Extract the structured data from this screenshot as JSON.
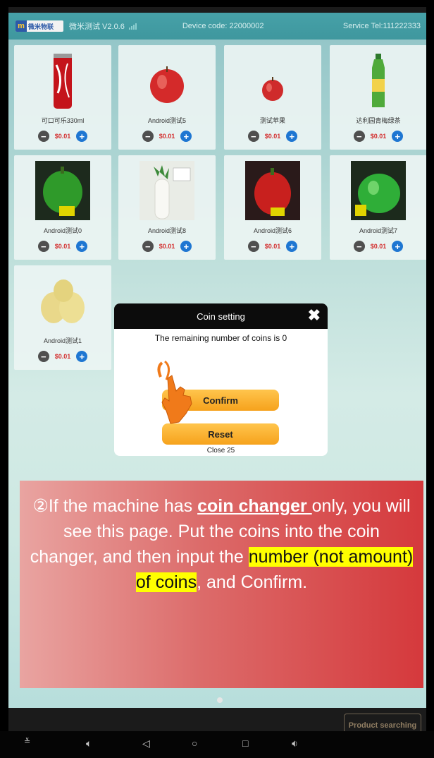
{
  "statusbar": {
    "logo_mark": "m",
    "logo_text": "微米物联",
    "app_version": "微米测试 V2.0.6",
    "device_code": "Device code:  22000002",
    "service_tel": "Service Tel:111222333"
  },
  "products": [
    {
      "name": "可口可乐330ml",
      "price": "$0.01",
      "image": "coke-can"
    },
    {
      "name": "Android测试5",
      "price": "$0.01",
      "image": "red-apple"
    },
    {
      "name": "测试苹果",
      "price": "$0.01",
      "image": "small-apple"
    },
    {
      "name": "达利园青梅绿茶",
      "price": "$0.01",
      "image": "green-tea-bottle"
    },
    {
      "name": "Android测试0",
      "price": "$0.01",
      "image": "green-pepper"
    },
    {
      "name": "Android测试8",
      "price": "$0.01",
      "image": "radish"
    },
    {
      "name": "Android测试6",
      "price": "$0.01",
      "image": "red-pepper"
    },
    {
      "name": "Android测试7",
      "price": "$0.01",
      "image": "green-apple"
    },
    {
      "name": "Android测试1",
      "price": "$0.01",
      "image": "pears"
    }
  ],
  "dialog": {
    "title": "Coin setting",
    "message": "The remaining number of coins is 0",
    "confirm_label": "Confirm",
    "reset_label": "Reset",
    "close_timer": "Close 25"
  },
  "callout": {
    "p1": "②If the machine has ",
    "coin_changer": "coin changer ",
    "p2": "only, you will see this page. Put the coins into the coin changer, and then input the ",
    "highlight": "number (not amount) of coins",
    "p3": ", and Confirm."
  },
  "footer": {
    "search_label": "Product searching"
  },
  "colors": {
    "accent_orange": "#f6a21c",
    "plus_blue": "#1e76d2",
    "price_red": "#d32f2f",
    "highlight_yellow": "#ffff00"
  }
}
